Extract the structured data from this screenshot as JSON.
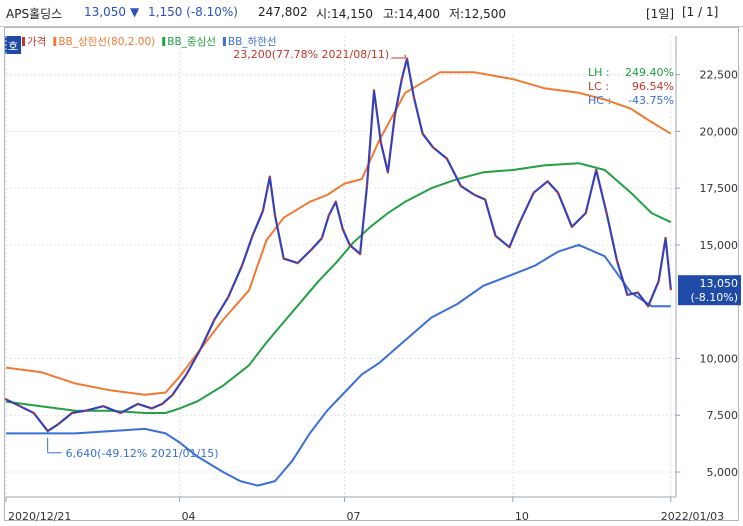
{
  "header": {
    "stock_name": "APS홀딩스",
    "price": "13,050",
    "change_arrow": "▼",
    "change": "1,150 (-8.10%)",
    "volume": "247,802",
    "open": "시:14,150",
    "high": "고:14,400",
    "low": "저:12,500",
    "period": "[1일]",
    "page": "[1 / 1]",
    "colors": {
      "down": "#2a52be",
      "text": "#222222"
    }
  },
  "side_tag": "호",
  "chart_data": {
    "type": "line",
    "legend": [
      {
        "label": "가격",
        "color": "#c0392b"
      },
      {
        "label": "BB_상한선(80,2.00)",
        "color": "#f07a33"
      },
      {
        "label": "BB_중심선",
        "color": "#22a043"
      },
      {
        "label": "BB_하한선",
        "color": "#3a6fd8"
      }
    ],
    "y_ticks": [
      "22,500",
      "20,000",
      "17,500",
      "15,000",
      "13,050",
      "10,000",
      "7,500",
      "5,000"
    ],
    "y_tick_values": [
      22500,
      20000,
      17500,
      15000,
      10000,
      7500,
      5000
    ],
    "ylim": [
      3900,
      24200
    ],
    "x_ticks": [
      "2020/12/21",
      "04",
      "07",
      "10",
      "2022/01/03"
    ],
    "x_tick_days": [
      0,
      100,
      195,
      292,
      383
    ],
    "x_range_days": [
      0,
      386
    ],
    "price_label": {
      "value": "13,050",
      "change": "(-8.10%)",
      "y": 13050
    },
    "stats": [
      {
        "label": "LH :",
        "value": "249.40%",
        "color": "#22a043"
      },
      {
        "label": "LC :",
        "value": "96.54%",
        "color": "#c0392b"
      },
      {
        "label": "HC :",
        "value": "-43.75%",
        "color": "#3a6fd8"
      }
    ],
    "annotations": [
      {
        "text": "23,200(77.78% 2021/08/11)",
        "day": 230,
        "y": 23200,
        "position": "left-above",
        "color": "#c0392b"
      },
      {
        "text": "6,640(-49.12% 2021/01/15)",
        "day": 24,
        "y": 6640,
        "position": "right-below",
        "color": "#3a6fd8"
      }
    ],
    "series": [
      {
        "name": "BB_상한선(80,2.00)",
        "color": "#f07a33",
        "points": [
          [
            0,
            9600
          ],
          [
            20,
            9400
          ],
          [
            40,
            8900
          ],
          [
            60,
            8600
          ],
          [
            80,
            8400
          ],
          [
            92,
            8500
          ],
          [
            100,
            9200
          ],
          [
            110,
            10200
          ],
          [
            125,
            11700
          ],
          [
            140,
            13000
          ],
          [
            150,
            15200
          ],
          [
            160,
            16200
          ],
          [
            175,
            16900
          ],
          [
            185,
            17200
          ],
          [
            195,
            17700
          ],
          [
            205,
            17900
          ],
          [
            215,
            19600
          ],
          [
            230,
            21700
          ],
          [
            250,
            22600
          ],
          [
            270,
            22600
          ],
          [
            292,
            22300
          ],
          [
            310,
            21900
          ],
          [
            330,
            21700
          ],
          [
            345,
            21400
          ],
          [
            360,
            21000
          ],
          [
            370,
            20500
          ],
          [
            383,
            19900
          ]
        ]
      },
      {
        "name": "BB_중심선",
        "color": "#22a043",
        "points": [
          [
            0,
            8100
          ],
          [
            20,
            7900
          ],
          [
            40,
            7700
          ],
          [
            60,
            7700
          ],
          [
            80,
            7600
          ],
          [
            92,
            7600
          ],
          [
            100,
            7800
          ],
          [
            110,
            8100
          ],
          [
            125,
            8800
          ],
          [
            140,
            9700
          ],
          [
            150,
            10700
          ],
          [
            160,
            11600
          ],
          [
            170,
            12500
          ],
          [
            180,
            13400
          ],
          [
            190,
            14200
          ],
          [
            200,
            15100
          ],
          [
            210,
            15800
          ],
          [
            220,
            16400
          ],
          [
            230,
            16900
          ],
          [
            245,
            17500
          ],
          [
            260,
            17900
          ],
          [
            275,
            18200
          ],
          [
            292,
            18300
          ],
          [
            310,
            18500
          ],
          [
            330,
            18600
          ],
          [
            345,
            18300
          ],
          [
            360,
            17300
          ],
          [
            372,
            16400
          ],
          [
            383,
            16000
          ]
        ]
      },
      {
        "name": "BB_하한선",
        "color": "#3a6fd8",
        "points": [
          [
            0,
            6700
          ],
          [
            20,
            6700
          ],
          [
            40,
            6700
          ],
          [
            60,
            6800
          ],
          [
            80,
            6900
          ],
          [
            92,
            6700
          ],
          [
            100,
            6300
          ],
          [
            110,
            5700
          ],
          [
            125,
            5000
          ],
          [
            135,
            4600
          ],
          [
            145,
            4400
          ],
          [
            155,
            4600
          ],
          [
            165,
            5500
          ],
          [
            175,
            6700
          ],
          [
            185,
            7700
          ],
          [
            195,
            8500
          ],
          [
            205,
            9300
          ],
          [
            215,
            9800
          ],
          [
            230,
            10800
          ],
          [
            245,
            11800
          ],
          [
            260,
            12400
          ],
          [
            275,
            13200
          ],
          [
            292,
            13700
          ],
          [
            305,
            14100
          ],
          [
            318,
            14700
          ],
          [
            330,
            15000
          ],
          [
            345,
            14500
          ],
          [
            360,
            12900
          ],
          [
            372,
            12300
          ],
          [
            383,
            12300
          ]
        ]
      },
      {
        "name": "가격",
        "color": "#3a3fb5",
        "points": [
          [
            0,
            8200
          ],
          [
            8,
            7900
          ],
          [
            16,
            7600
          ],
          [
            24,
            6800
          ],
          [
            30,
            7100
          ],
          [
            38,
            7600
          ],
          [
            46,
            7700
          ],
          [
            56,
            7900
          ],
          [
            66,
            7600
          ],
          [
            76,
            8000
          ],
          [
            84,
            7800
          ],
          [
            90,
            8000
          ],
          [
            96,
            8400
          ],
          [
            104,
            9300
          ],
          [
            112,
            10400
          ],
          [
            120,
            11700
          ],
          [
            128,
            12700
          ],
          [
            136,
            14100
          ],
          [
            142,
            15400
          ],
          [
            148,
            16500
          ],
          [
            152,
            18000
          ],
          [
            155,
            16300
          ],
          [
            160,
            14400
          ],
          [
            168,
            14200
          ],
          [
            176,
            14800
          ],
          [
            182,
            15300
          ],
          [
            186,
            16300
          ],
          [
            190,
            16900
          ],
          [
            194,
            15700
          ],
          [
            198,
            15000
          ],
          [
            204,
            14600
          ],
          [
            208,
            17600
          ],
          [
            212,
            21800
          ],
          [
            216,
            19500
          ],
          [
            220,
            18200
          ],
          [
            224,
            20700
          ],
          [
            228,
            22300
          ],
          [
            231,
            23200
          ],
          [
            235,
            21500
          ],
          [
            240,
            19900
          ],
          [
            246,
            19300
          ],
          [
            254,
            18800
          ],
          [
            262,
            17600
          ],
          [
            270,
            17200
          ],
          [
            276,
            17000
          ],
          [
            282,
            15400
          ],
          [
            290,
            14900
          ],
          [
            296,
            16000
          ],
          [
            304,
            17300
          ],
          [
            312,
            17800
          ],
          [
            318,
            17300
          ],
          [
            326,
            15800
          ],
          [
            334,
            16400
          ],
          [
            340,
            18300
          ],
          [
            346,
            16400
          ],
          [
            352,
            14300
          ],
          [
            358,
            12800
          ],
          [
            364,
            12900
          ],
          [
            370,
            12300
          ],
          [
            376,
            13400
          ],
          [
            380,
            15300
          ],
          [
            383,
            13050
          ]
        ]
      }
    ]
  }
}
